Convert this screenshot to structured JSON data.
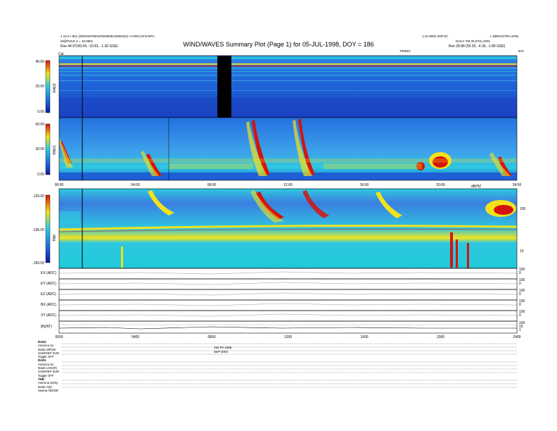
{
  "header": {
    "title": "WIND/WAVES Summary Plot (Page 1) for 05-JUL-1998, DOY = 186",
    "left_line1": "1.10.0 • 801 (0000/SP/090SP/D090/D100/E004) • 0.RECOFG/SPC",
    "left_line2": "Mi@P.M.E.2 = 10,0901",
    "left_line3": "Rse     44.97(43.64, -10.81, -1.30 GSE)",
    "right_line1": "1.10 WED 20/FOC",
    "right_line2": "L.DBROSTRA.SPDI",
    "right_line3": "DAILY TM 28 (FIS) 2002",
    "right_line4": "Rse     28.88 (59.35, -4.30, -1.89 GSE)",
    "center_small": "TIMING",
    "right_corner": "kHz"
  },
  "panels": {
    "rad2": {
      "label": "RAD2",
      "ticks": [
        "40.00",
        "20.00",
        "0.00"
      ]
    },
    "rad1": {
      "label": "RAD1",
      "ticks": [
        "60.00",
        "30.00",
        "0.00"
      ]
    },
    "tnr": {
      "label": "TNR",
      "ticks": [
        "-120.00",
        "-135.00",
        "-150.00"
      ],
      "right_ticks": [
        "100",
        "10"
      ]
    },
    "tnr_top_right": "dB/HZ",
    "cal_marker": "Cal",
    "time_ticks": [
      "00:00",
      "04:00",
      "08:00",
      "12:00",
      "16:00",
      "20:00",
      "24:00"
    ],
    "bottom_time_ticks": [
      "0000",
      "0400",
      "0800",
      "1200",
      "1600",
      "2000",
      "2400"
    ],
    "line_plots": [
      {
        "label": "EX (ADC)",
        "right": [
          "100",
          "0"
        ]
      },
      {
        "label": "EY (ADC)",
        "right": [
          "100",
          "0"
        ]
      },
      {
        "label": "EZ (ADC)",
        "right": [
          "100",
          "0"
        ]
      },
      {
        "label": "BX (ADC)",
        "right": [
          "100",
          "0"
        ]
      },
      {
        "label": "XY (ADC)",
        "right": [
          "100",
          "0"
        ]
      },
      {
        "label": "|B|(NT)",
        "right": [
          "100",
          "10",
          "1"
        ]
      }
    ]
  },
  "colors": {
    "bg_blue": "#1e5fd6",
    "cyan": "#2ec8e0",
    "yellow": "#f2e21c",
    "red": "#d4140c"
  },
  "info": {
    "rad2_head": "RAD2",
    "rad2_lines": [
      "Antenna       Sx",
      "Mode      MR\\SX",
      "SUM/SEP  SUM",
      "Toggle      OFF"
    ],
    "rad1_head": "RAD1",
    "rad1_lines": [
      "Antenna       Sx",
      "Mode    LOG(R)",
      "SUM/SEP  SUM",
      "Toggle      OFF"
    ],
    "tnr_head": "TNR",
    "tnr_lines": [
      "Antenna   Sx/Sy",
      "Mode         A(5)",
      "Sweep  ABCDE"
    ],
    "center_note1": "192 PA    1998",
    "center_note2": "SEP           DW4"
  },
  "chart_data": [
    {
      "type": "heatmap",
      "title": "RAD2",
      "x": [
        0,
        24
      ],
      "ylim": [
        0,
        40
      ],
      "description_ticks": [
        "40.00",
        "20.00",
        "0.00"
      ]
    },
    {
      "type": "heatmap",
      "title": "RAD1",
      "x": [
        0,
        24
      ],
      "ylim": [
        0,
        60
      ],
      "events_hours": [
        0.5,
        6.2,
        12.0,
        12.2,
        15.5,
        19.8,
        20.5,
        23.2
      ]
    },
    {
      "type": "heatmap",
      "title": "TNR",
      "x": [
        0,
        24
      ],
      "ylim": [
        -150,
        -120
      ],
      "right_axis_labels": [
        "100",
        "10"
      ]
    },
    {
      "type": "line",
      "title": "EX/EY/EZ/BX/XY (ADC), |B|(NT)",
      "x": [
        0,
        24
      ],
      "series": [
        {
          "name": "EX (ADC)"
        },
        {
          "name": "EY (ADC)"
        },
        {
          "name": "EZ (ADC)"
        },
        {
          "name": "BX (ADC)"
        },
        {
          "name": "XY (ADC)"
        },
        {
          "name": "|B|(NT)"
        }
      ]
    }
  ]
}
